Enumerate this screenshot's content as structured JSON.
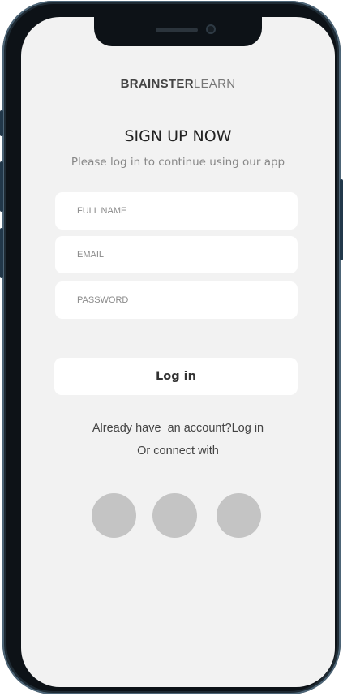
{
  "logo": {
    "bold": "BRAINSTER",
    "light": "LEARN"
  },
  "title": "SIGN UP NOW",
  "subtitle": "Please log in to continue using our app",
  "form": {
    "full_name_placeholder": "FULL NAME",
    "email_placeholder": "EMAIL",
    "password_placeholder": "PASSWORD"
  },
  "login_button": "Log in",
  "already_text": "Already have  an account?",
  "already_link": "Log in",
  "connect_text": "Or connect with",
  "social_buttons": [
    "social-button-1",
    "social-button-2",
    "social-button-3"
  ],
  "colors": {
    "screen_bg": "#f2f2f2",
    "field_bg": "#ffffff",
    "social_circle": "#c4c4c4",
    "phone_frame": "#1e2a33"
  }
}
